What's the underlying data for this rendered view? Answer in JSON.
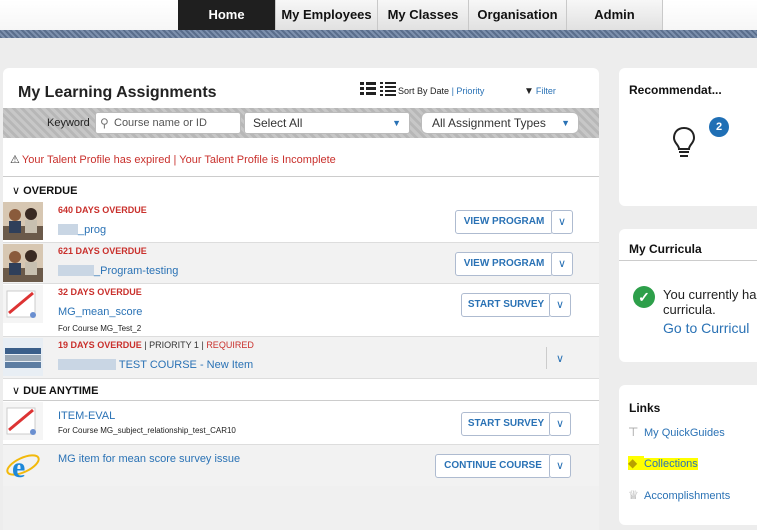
{
  "nav": {
    "tabs": [
      "Home",
      "My Employees",
      "My Classes",
      "Organisation",
      "Admin"
    ]
  },
  "assignments": {
    "title": "My Learning Assignments",
    "sort_prefix": "Sort By",
    "sort_date": "Date",
    "sort_sep": "|",
    "sort_priority": "Priority",
    "filter_label": "Filter",
    "keyword_label": "Keyword",
    "search_placeholder": "Course name or ID",
    "select_all": "Select All",
    "assignment_types": "All Assignment Types",
    "warning_1": "Your Talent Profile has expired",
    "warning_sep": "|",
    "warning_2": "Your Talent Profile is Incomplete",
    "sections": {
      "overdue": "OVERDUE",
      "due_anytime": "DUE ANYTIME"
    },
    "items": [
      {
        "status": "640 DAYS OVERDUE",
        "title": "_prog",
        "action": "VIEW PROGRAM"
      },
      {
        "status": "621 DAYS OVERDUE",
        "title": "_Program-testing",
        "action": "VIEW PROGRAM"
      },
      {
        "status": "32 DAYS OVERDUE",
        "title": "MG_mean_score",
        "subtitle": "For Course MG_Test_2",
        "action": "START SURVEY"
      },
      {
        "status": "19 DAYS OVERDUE",
        "priority": "PRIORITY 1",
        "required": "REQUIRED",
        "sep": "|",
        "title": "TEST COURSE - New Item"
      },
      {
        "title": "ITEM-EVAL",
        "subtitle": "For Course MG_subject_relationship_test_CAR10",
        "action": "START SURVEY"
      },
      {
        "title": "MG item for mean score survey issue",
        "action": "CONTINUE COURSE"
      }
    ]
  },
  "recommendations": {
    "title": "Recommendat...",
    "count": "2"
  },
  "curricula": {
    "title": "My Curricula",
    "text_1": "You currently ha",
    "text_2": "curricula.",
    "link": "Go to Curricul"
  },
  "links": {
    "title": "Links",
    "items": [
      "My QuickGuides",
      "Collections",
      "Accomplishments"
    ]
  },
  "colors": {
    "accent": "#2a72b5",
    "overdue": "#c9302c",
    "badge": "#1f6fb5",
    "success": "#2d9f4a",
    "highlight": "#ffff00"
  },
  "icons": [
    "search-icon",
    "filter-icon",
    "list-view-icon",
    "detail-view-icon",
    "warning-icon",
    "lightbulb-icon",
    "checkmark-icon",
    "signpost-icon",
    "trophy-icon",
    "internet-explorer-icon"
  ]
}
